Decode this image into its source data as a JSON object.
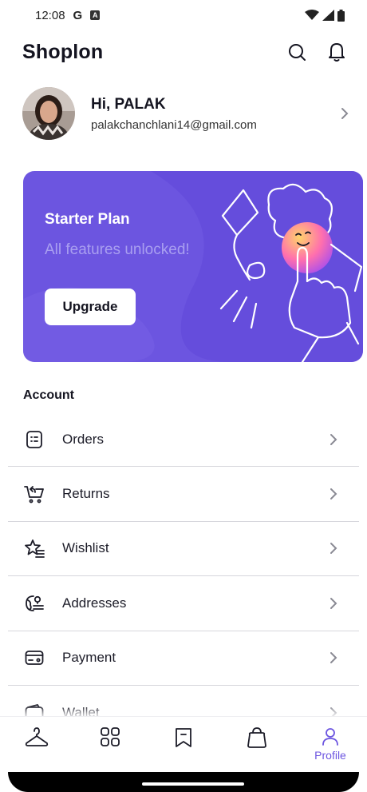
{
  "status_bar": {
    "time": "12:08",
    "g_label": "G",
    "a_label": "A"
  },
  "header": {
    "title": "Shoplon"
  },
  "profile": {
    "greeting": "Hi, PALAK",
    "email": "palakchanchlani14@gmail.com"
  },
  "promo": {
    "title": "Starter Plan",
    "subtitle": "All features unlocked!",
    "button_label": "Upgrade"
  },
  "account": {
    "section_title": "Account",
    "items": [
      {
        "label": "Orders",
        "icon": "orders-icon"
      },
      {
        "label": "Returns",
        "icon": "returns-icon"
      },
      {
        "label": "Wishlist",
        "icon": "wishlist-icon"
      },
      {
        "label": "Addresses",
        "icon": "addresses-icon"
      },
      {
        "label": "Payment",
        "icon": "payment-icon"
      },
      {
        "label": "Wallet",
        "icon": "wallet-icon"
      }
    ]
  },
  "bottom_nav": {
    "profile_label": "Profile"
  },
  "colors": {
    "accent": "#6c55e0",
    "text": "#1c1c28",
    "divider": "#d6d6dc"
  }
}
